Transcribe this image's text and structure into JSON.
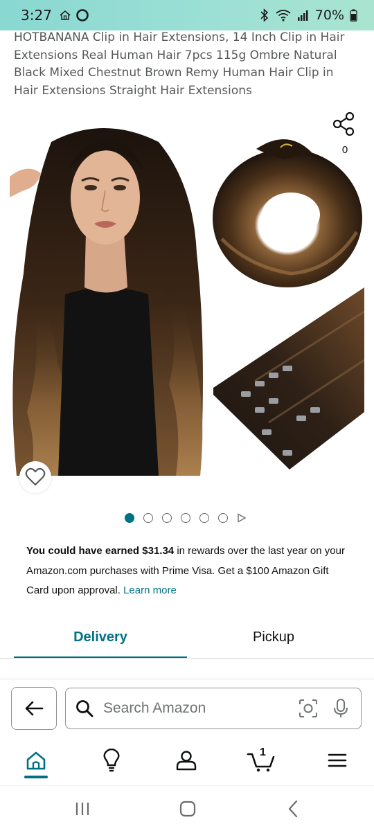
{
  "status_bar": {
    "time": "3:27",
    "battery": "70%"
  },
  "product": {
    "title": "HOTBANANA Clip in Hair Extensions, 14 Inch Clip in Hair Extensions Real Human Hair 7pcs 115g Ombre Natural Black Mixed Chestnut Brown Remy Human Hair Clip in Hair Extensions Straight Hair Extensions",
    "share_count": "0",
    "image_count": 6,
    "active_image_index": 0
  },
  "rewards": {
    "lead": "You could have earned $31.34",
    "body": " in rewards over the last year on your Amazon.com purchases with Prime Visa. Get a $100 Amazon Gift Card upon approval. ",
    "link": "Learn more"
  },
  "tabs": {
    "delivery": "Delivery",
    "pickup": "Pickup",
    "active": "Delivery"
  },
  "search": {
    "placeholder": "Search Amazon"
  },
  "bottom_nav": {
    "cart_count": "1",
    "active": "home"
  },
  "colors": {
    "accent": "#007185",
    "status_bar": "#9de0d5"
  }
}
